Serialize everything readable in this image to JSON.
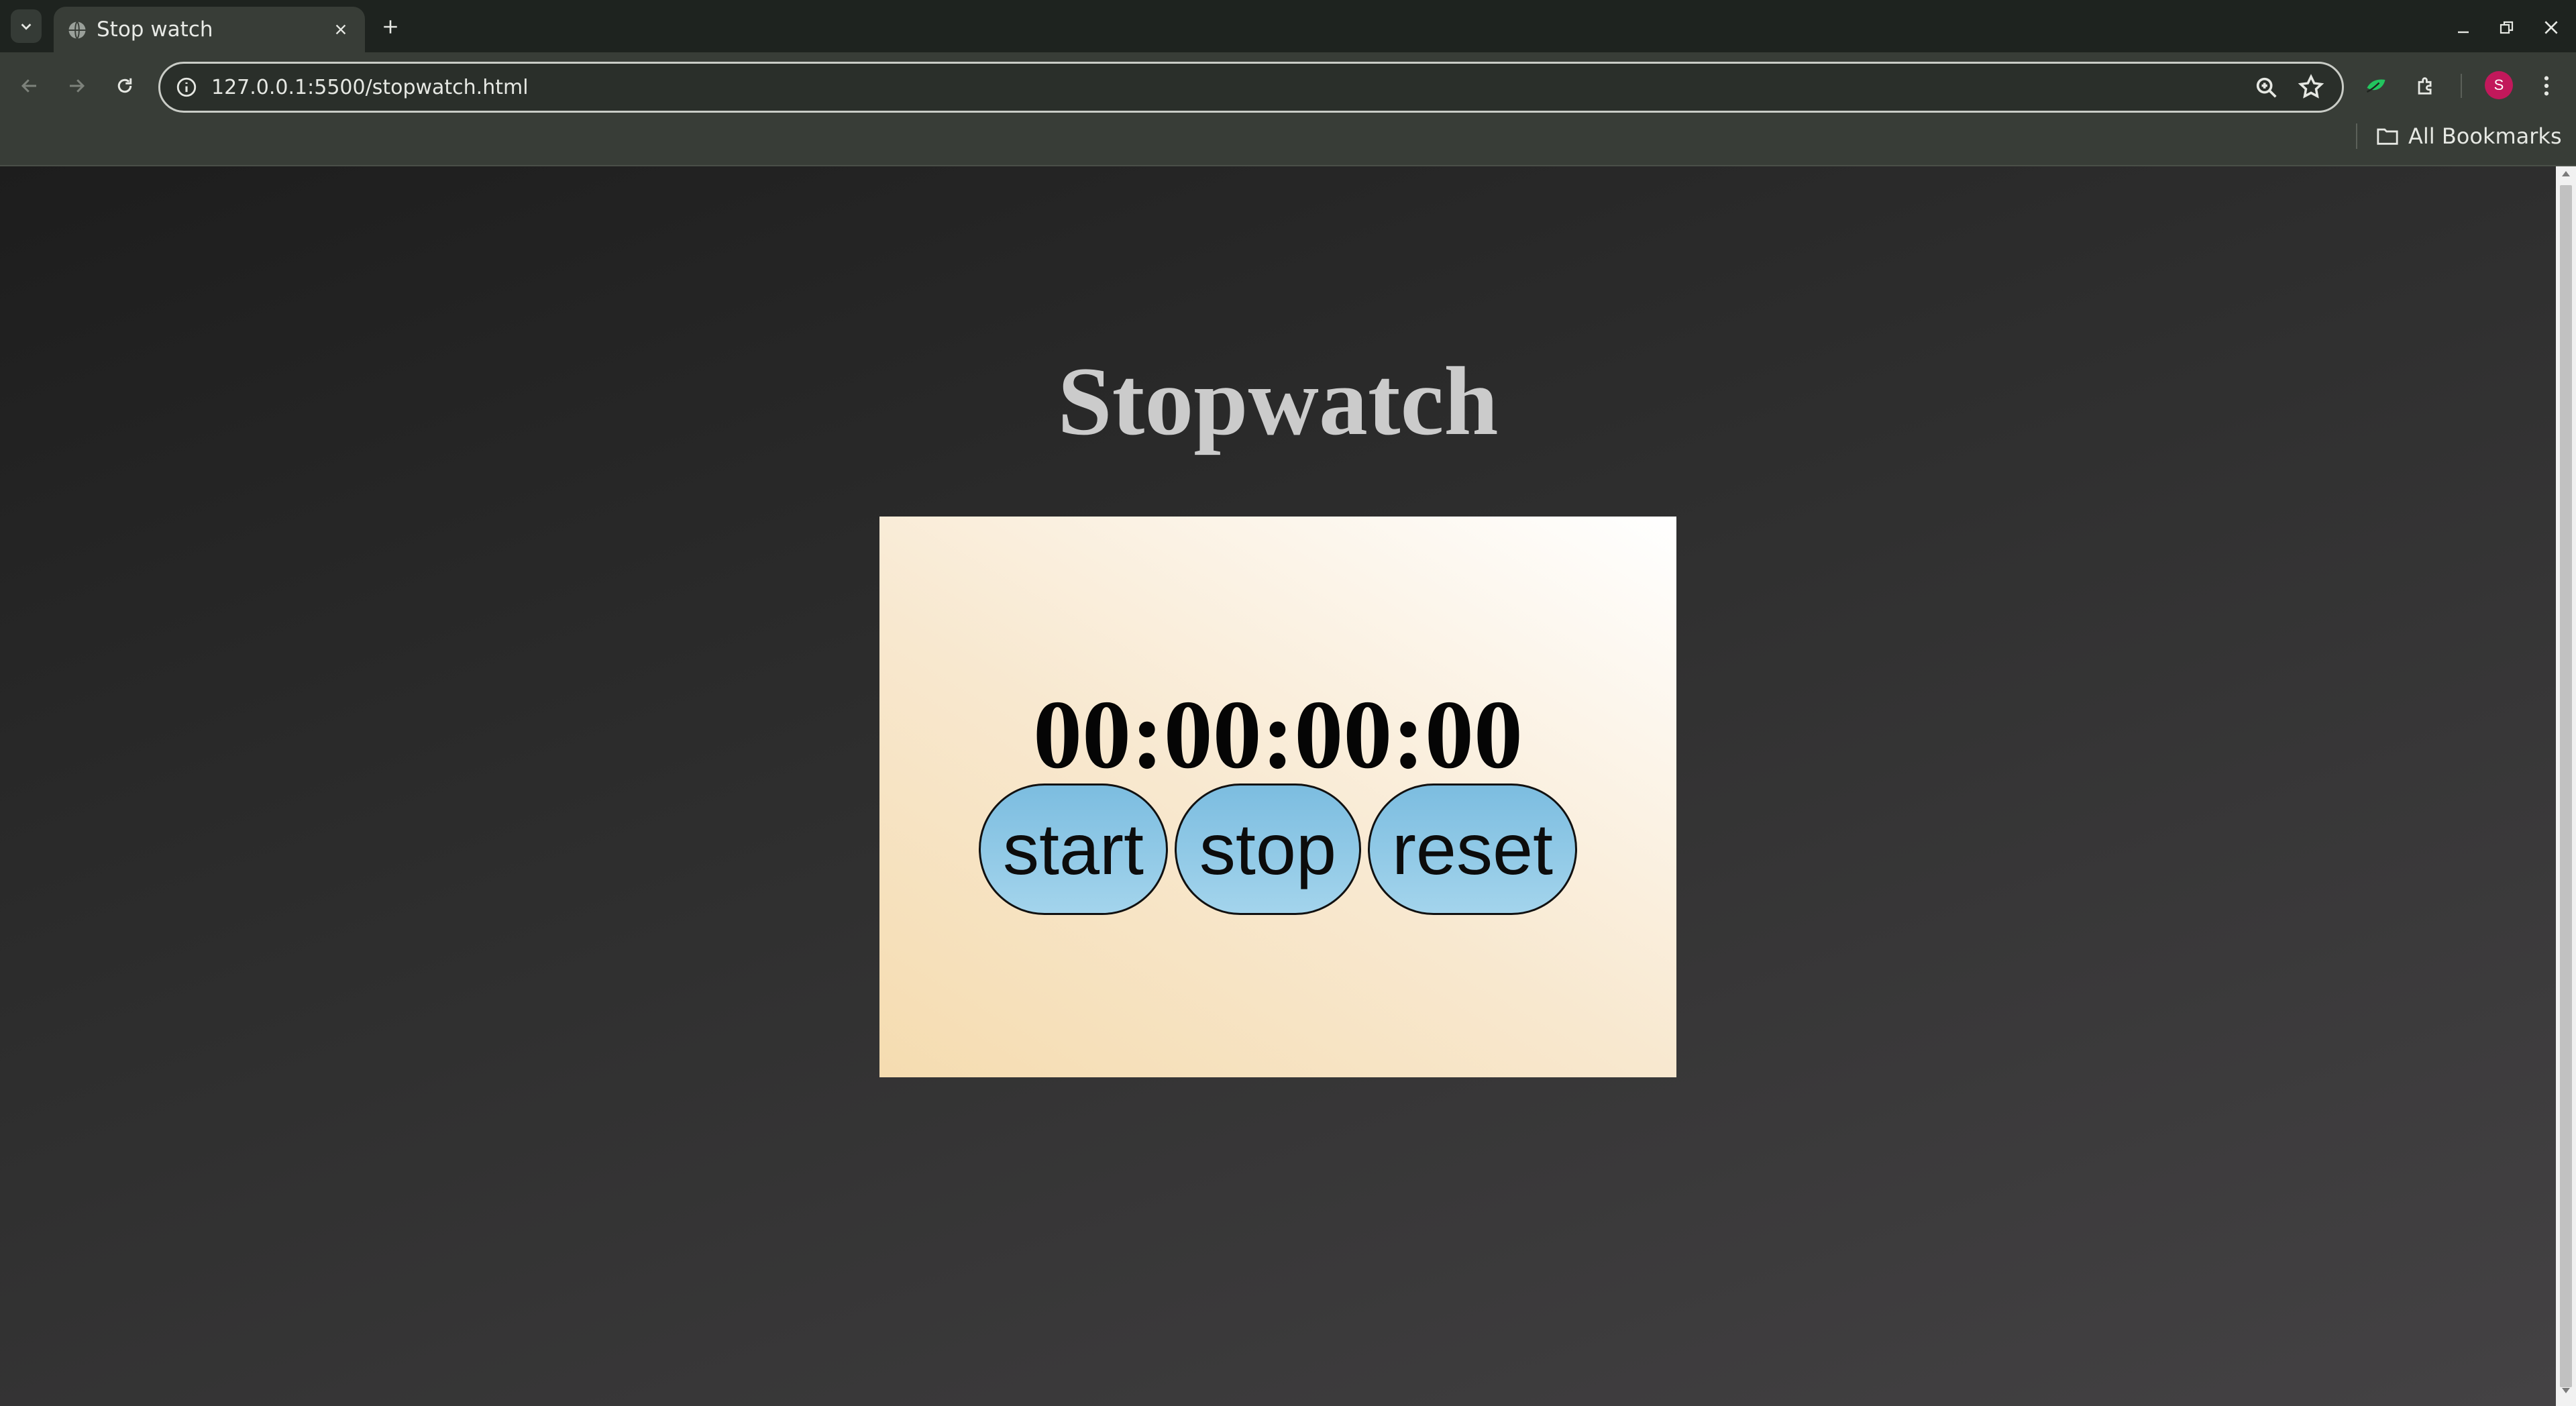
{
  "browser": {
    "tab_title": "Stop watch",
    "url": "127.0.0.1:5500/stopwatch.html",
    "bookmarks_label": "All Bookmarks",
    "profile_initial": "S",
    "profile_color": "#c2185b"
  },
  "page": {
    "title": "Stopwatch",
    "time": "00:00:00:00",
    "buttons": {
      "start": "start",
      "stop": "stop",
      "reset": "reset"
    },
    "colors": {
      "button_fill": "#7cbde0",
      "title": "#cbcbcb",
      "card_gradient_start": "#f5dcb0",
      "card_gradient_end": "#ffffff"
    }
  }
}
